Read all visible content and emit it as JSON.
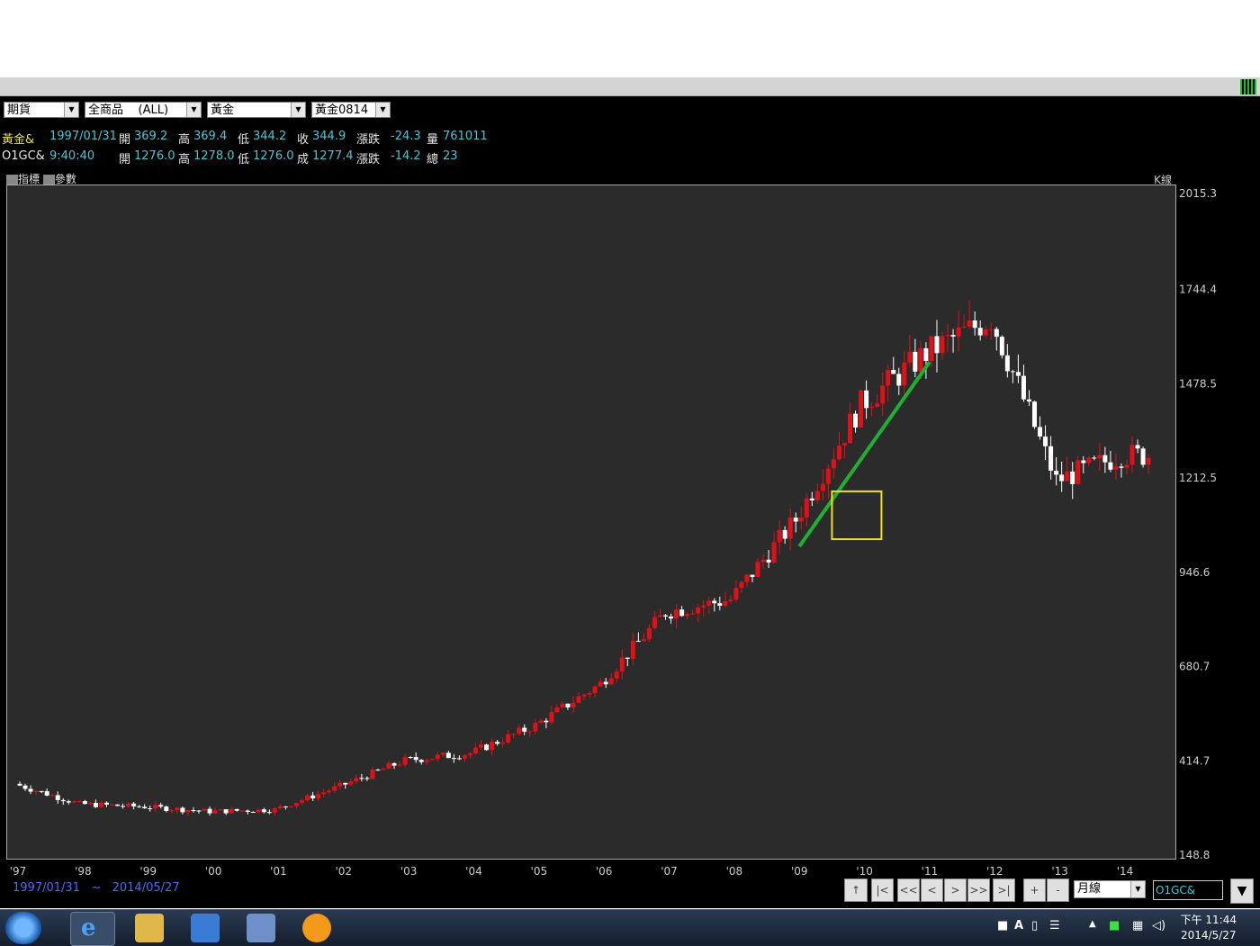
{
  "toolbar": {
    "market": "期貨",
    "product": "全商品    (ALL)",
    "commodity": "黃金",
    "contract": "黃金0814"
  },
  "quote1": {
    "name": "黃金&",
    "date": "1997/01/31",
    "open_label": "開",
    "open": "369.2",
    "high_label": "高",
    "high": "369.4",
    "low_label": "低",
    "low": "344.2",
    "close_label": "收",
    "close": "344.9",
    "change_label": "漲跌",
    "change": "-24.3",
    "volume_label": "量",
    "volume": "761011"
  },
  "quote2": {
    "name": "O1GC&",
    "time": "9:40:40",
    "open_label": "開",
    "open": "1276.0",
    "high_label": "高",
    "high": "1278.0",
    "low_label": "低",
    "low": "1276.0",
    "close_label": "成",
    "close": "1277.4",
    "change_label": "漲跌",
    "change": "-14.2",
    "volume_label": "總",
    "volume": "23"
  },
  "chart_tabs": {
    "indicator": "指標",
    "params": "參數",
    "kline": "K線"
  },
  "chart_data": {
    "type": "candlestick",
    "period": "月線",
    "y_ticks": [
      "2015.3",
      "1744.4",
      "1478.5",
      "1212.5",
      "946.6",
      "680.7",
      "414.7",
      "148.8"
    ],
    "ylim": [
      148.8,
      2015.3
    ],
    "x_ticks": [
      "'97",
      "'98",
      "'99",
      "'00",
      "'01",
      "'02",
      "'03",
      "'04",
      "'05",
      "'06",
      "'07",
      "'08",
      "'09",
      "'10",
      "'11",
      "'12",
      "'13",
      "'14"
    ],
    "series": [
      {
        "x": [
          "1997",
          "1998",
          "1999",
          "2000",
          "2001",
          "2002",
          "2003",
          "2004",
          "2005",
          "2006",
          "2007",
          "2008",
          "2009",
          "2010",
          "2011",
          "2012",
          "2013",
          "2014"
        ],
        "values": [
          350,
          293,
          285,
          272,
          277,
          343,
          416,
          436,
          515,
          632,
          834,
          870,
          1095,
          1420,
          1565,
          1664,
          1205,
          1277
        ]
      }
    ],
    "annotations": [
      "trend-line",
      "highlight-box"
    ],
    "colors": {
      "up": "#e01018",
      "down": "#ffffff",
      "trend": "#20b030",
      "box": "#f0e020",
      "bg": "#2b2b2b"
    }
  },
  "footer": {
    "range": "1997/01/31   ~   2014/05/27",
    "nav": [
      "↑",
      "|<",
      "<<",
      "<",
      ">",
      ">>",
      ">|",
      "+",
      "-"
    ],
    "period": "月線",
    "symbol": "O1GC&",
    "dropdown": "▼"
  },
  "taskbar": {
    "time": "下午 11:44",
    "date": "2014/5/27"
  }
}
